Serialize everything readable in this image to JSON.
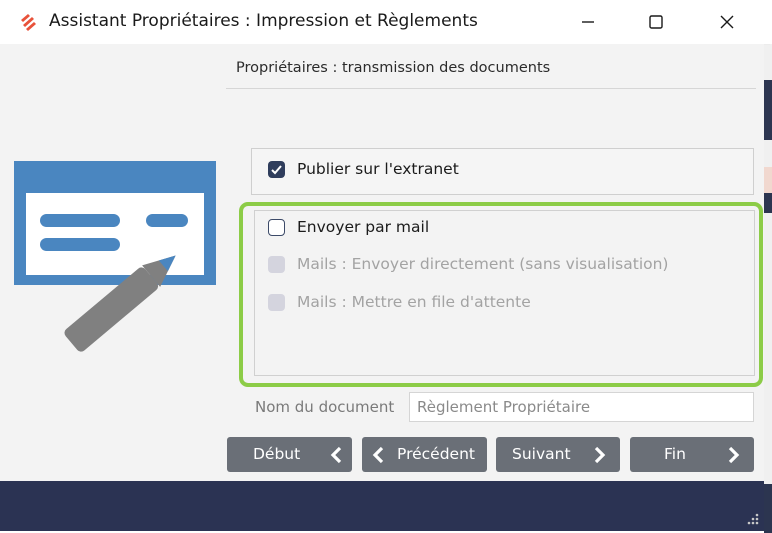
{
  "window": {
    "title": "Assistant Propriétaires : Impression et Règlements",
    "controls": [
      "minimize",
      "maximize",
      "close"
    ]
  },
  "section": {
    "title": "Propriétaires : transmission des documents"
  },
  "options": {
    "extranet": {
      "label": "Publier sur l'extranet",
      "checked": true
    },
    "mail": {
      "label": "Envoyer par mail",
      "checked": false
    },
    "mail_direct": {
      "label": "Mails : Envoyer directement (sans visualisation)",
      "enabled": false
    },
    "mail_queue": {
      "label": "Mails : Mettre en file d'attente",
      "enabled": false
    }
  },
  "document": {
    "name_label": "Nom du document",
    "name_value": "Règlement Propriétaire"
  },
  "nav": {
    "start": "Début",
    "previous": "Précédent",
    "next": "Suivant",
    "end": "Fin"
  },
  "colors": {
    "highlight": "#8ccc47",
    "footer": "#2b3353",
    "button": "#6a6f77",
    "illustration": "#4a86c0",
    "checkbox": "#2f3d5c"
  },
  "icons": {
    "app_logo": "stacked-chevrons-logo",
    "illustration": "card-with-pencil",
    "start": "chevron-left-icon",
    "previous": "chevron-left-icon",
    "next": "chevron-right-icon",
    "end": "chevron-right-icon"
  }
}
